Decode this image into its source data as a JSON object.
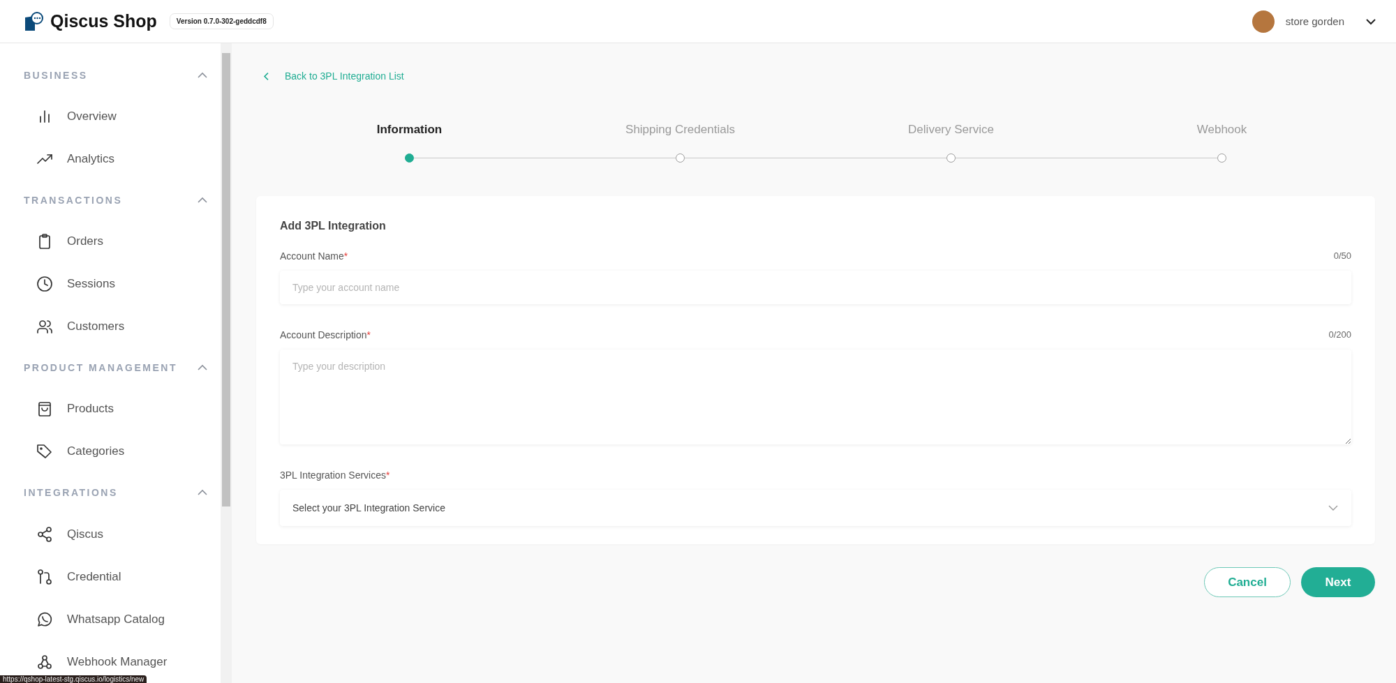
{
  "header": {
    "brand": "Qiscus Shop",
    "version": "Version 0.7.0-302-geddcdf8",
    "user": {
      "name": "store gorden"
    }
  },
  "sidebar": {
    "sections": [
      {
        "title": "BUSINESS",
        "expanded": true,
        "items": [
          {
            "label": "Overview"
          },
          {
            "label": "Analytics"
          }
        ]
      },
      {
        "title": "TRANSACTIONS",
        "expanded": true,
        "items": [
          {
            "label": "Orders"
          },
          {
            "label": "Sessions"
          },
          {
            "label": "Customers"
          }
        ]
      },
      {
        "title": "PRODUCT MANAGEMENT",
        "expanded": true,
        "items": [
          {
            "label": "Products"
          },
          {
            "label": "Categories"
          }
        ]
      },
      {
        "title": "INTEGRATIONS",
        "expanded": true,
        "items": [
          {
            "label": "Qiscus"
          },
          {
            "label": "Credential"
          },
          {
            "label": "Whatsapp Catalog"
          },
          {
            "label": "Webhook Manager"
          }
        ]
      }
    ]
  },
  "status_url": "https://qshop-latest-stg.qiscus.io/logistics/new",
  "back_link": "Back to 3PL Integration List",
  "steps": [
    {
      "label": "Information",
      "selected": true
    },
    {
      "label": "Shipping Credentials",
      "selected": false
    },
    {
      "label": "Delivery Service",
      "selected": false
    },
    {
      "label": "Webhook",
      "selected": false
    }
  ],
  "form": {
    "title": "Add 3PL Integration",
    "required_mark": "*",
    "fields": [
      {
        "kind": "input",
        "label": "Account Name",
        "required": true,
        "counter": "0/50",
        "placeholder": "Type your account name"
      },
      {
        "kind": "textarea",
        "label": "Account Description",
        "required": true,
        "counter": "0/200",
        "placeholder": "Type your description"
      },
      {
        "kind": "select",
        "label": "3PL Integration Services",
        "required": true,
        "value": "Select your 3PL Integration Service"
      }
    ]
  },
  "buttons": {
    "cancel": "Cancel",
    "next": "Next"
  }
}
